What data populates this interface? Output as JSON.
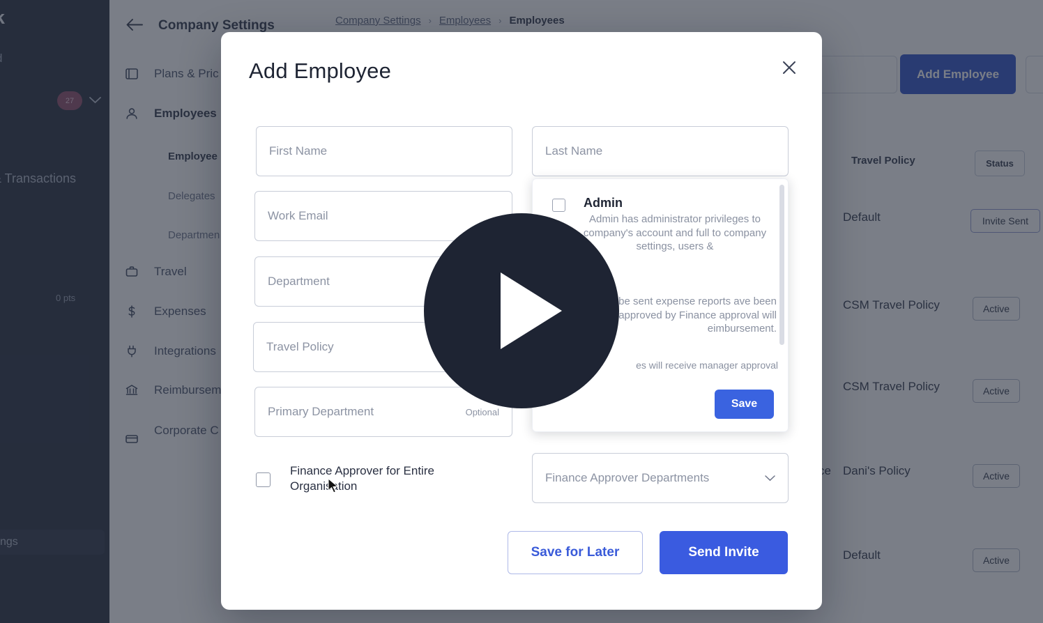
{
  "rail": {
    "brand": "ank",
    "item_d": "d",
    "badge": "27",
    "chevron": "chevron-down",
    "transactions": "& Transactions",
    "points": "0 pts",
    "settings": "ngs"
  },
  "settings_nav": {
    "back_icon": "arrow-left",
    "title": "Company Settings",
    "items": [
      {
        "label": "Plans & Pric",
        "icon": "plans-icon",
        "active": false
      },
      {
        "label": "Employees",
        "icon": "user-icon",
        "active": true
      },
      {
        "label": "Travel",
        "icon": "briefcase-icon",
        "active": false
      },
      {
        "label": "Expenses",
        "icon": "dollar-icon",
        "active": false
      },
      {
        "label": "Integrations",
        "icon": "plug-icon",
        "active": false
      },
      {
        "label": "Reimbursem",
        "icon": "bank-icon",
        "active": false
      },
      {
        "label": "Corporate C Connections",
        "icon": "card-icon",
        "active": false
      }
    ],
    "subitems": [
      {
        "label": "Employee D",
        "active": true
      },
      {
        "label": "Delegates",
        "active": false
      },
      {
        "label": "Departmen",
        "active": false
      }
    ]
  },
  "breadcrumb": {
    "items": [
      "Company Settings",
      "Employees",
      "Employees"
    ],
    "separator": "›"
  },
  "toolbar": {
    "add_employee_label": "Add Employee"
  },
  "table": {
    "headers": {
      "travel_policy": "Travel Policy",
      "status": "Status"
    },
    "rows": [
      {
        "travel_policy": "Default",
        "status": "Invite Sent",
        "dept": ""
      },
      {
        "travel_policy": "CSM Travel Policy",
        "status": "Active",
        "dept": ""
      },
      {
        "travel_policy": "CSM Travel Policy",
        "status": "Active",
        "dept": ""
      },
      {
        "travel_policy": "Dani's Policy",
        "status": "Active",
        "dept": "ce"
      },
      {
        "travel_policy": "Default",
        "status": "Active",
        "dept": ""
      }
    ]
  },
  "modal": {
    "title": "Add Employee",
    "close_icon": "close-icon",
    "fields": {
      "first_name": {
        "placeholder": "First Name",
        "value": ""
      },
      "last_name": {
        "placeholder": "Last Name",
        "value": ""
      },
      "work_email": {
        "placeholder": "Work Email",
        "value": ""
      },
      "department": {
        "placeholder": "Department",
        "value": ""
      },
      "travel_policy": {
        "placeholder": "Travel Policy",
        "value": ""
      },
      "primary_department": {
        "placeholder": "Primary Department",
        "value": "",
        "hint": "Optional"
      },
      "finance_approver_departments": {
        "placeholder": "Finance Approver Departments",
        "value": "",
        "caret": "chevron-down"
      }
    },
    "role_panel": {
      "role_name": "Admin",
      "role_desc": "Admin has administrator privileges to company's account and full to company settings, users &",
      "role_desc_2": "l be sent expense reports ave been approved by Finance approval will eimbursement.",
      "role_desc_3": "es will receive manager approval",
      "save_label": "Save"
    },
    "finance_checkbox_label": "Finance Approver for Entire Organisation",
    "save_for_later_label": "Save for Later",
    "send_invite_label": "Send Invite"
  },
  "overlay": {
    "play_icon": "play-icon"
  },
  "colors": {
    "primary_blue": "#3A5BE0",
    "dark_blue": "#2B50C8",
    "rail_dark": "#232B3B",
    "overlay_dark": "#1E2433"
  }
}
